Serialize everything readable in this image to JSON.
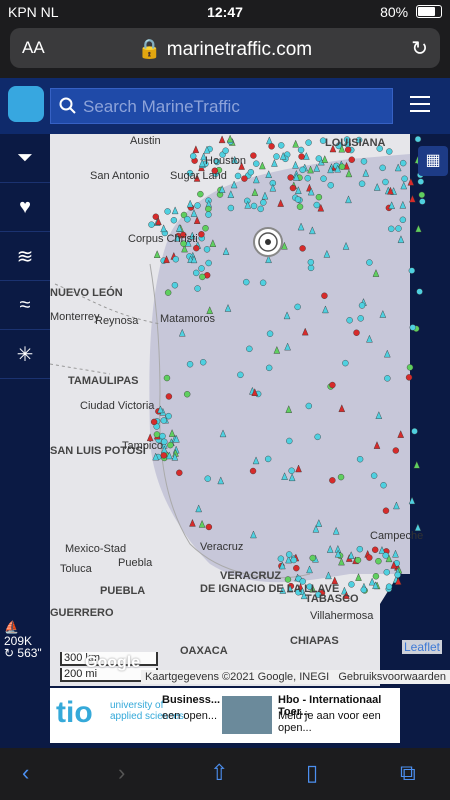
{
  "status_bar": {
    "carrier": "KPN NL",
    "time": "12:47",
    "battery": "80%"
  },
  "browser": {
    "text_size_label": "AA",
    "domain": "marinetraffic.com"
  },
  "app": {
    "search_placeholder": "Search MarineTraffic",
    "sidebar_icons": [
      "filter-icon",
      "heart-icon",
      "layers-icon",
      "wind-icon",
      "network-icon"
    ],
    "vessel_count": "209K",
    "refresh_interval": "563\""
  },
  "map": {
    "places": [
      {
        "name": "Austin",
        "kind": "city"
      },
      {
        "name": "Houston",
        "kind": "city"
      },
      {
        "name": "San Antonio",
        "kind": "city"
      },
      {
        "name": "Sugar Land",
        "kind": "city"
      },
      {
        "name": "LOUISIANA",
        "kind": "region"
      },
      {
        "name": "Corpus Christi",
        "kind": "city"
      },
      {
        "name": "NUEVO LEÓN",
        "kind": "region"
      },
      {
        "name": "Monterrey",
        "kind": "city"
      },
      {
        "name": "Reynosa",
        "kind": "city"
      },
      {
        "name": "Matamoros",
        "kind": "city"
      },
      {
        "name": "TAMAULIPAS",
        "kind": "region"
      },
      {
        "name": "Ciudad Victoria",
        "kind": "city"
      },
      {
        "name": "SAN LUIS POTOSÍ",
        "kind": "region"
      },
      {
        "name": "Tampico",
        "kind": "city"
      },
      {
        "name": "Mexico-Stad",
        "kind": "city"
      },
      {
        "name": "Toluca",
        "kind": "city"
      },
      {
        "name": "Puebla",
        "kind": "city"
      },
      {
        "name": "PUEBLA",
        "kind": "region"
      },
      {
        "name": "Veracruz",
        "kind": "city"
      },
      {
        "name": "VERACRUZ DE IGNACIO DE LA LLAVE",
        "kind": "region"
      },
      {
        "name": "GUERRERO",
        "kind": "region"
      },
      {
        "name": "OAXACA",
        "kind": "region"
      },
      {
        "name": "TABASCO",
        "kind": "region"
      },
      {
        "name": "Villahermosa",
        "kind": "city"
      },
      {
        "name": "CHIAPAS",
        "kind": "region"
      },
      {
        "name": "Campeche",
        "kind": "city"
      }
    ],
    "scale_km": "300 km",
    "scale_mi": "200 mi",
    "attribution": "Kaartgegevens ©2021 Google, INEGI",
    "terms": "Gebruiksvoorwaarden",
    "leaflet": "Leaflet",
    "google": "Google"
  },
  "ad": {
    "logo_text": "tio",
    "logo_sub": "university of applied sciences",
    "item1_title": "Business...",
    "item1_sub": "een open...",
    "item2_title": "Hbo - Internationaal Toer...",
    "item2_sub": "Meld je aan voor een open..."
  },
  "colors": {
    "nav": "#0f2a6b",
    "search": "#1f4aa8",
    "gulf": "#c7c7d9",
    "cargo": "#4fd0e0",
    "tanker": "#d62b2b",
    "passenger": "#5fcf5f"
  }
}
